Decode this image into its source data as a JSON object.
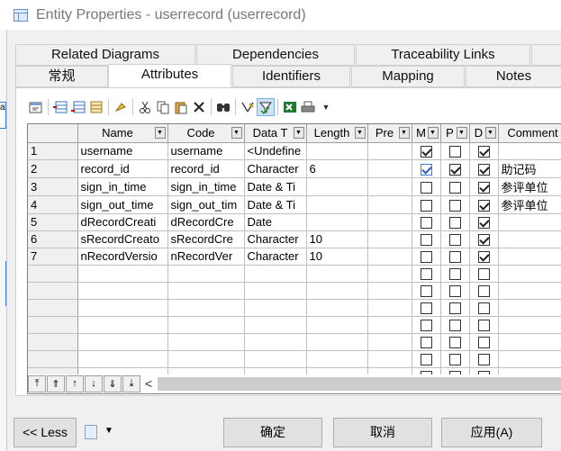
{
  "window": {
    "title": "Entity Properties - userrecord (userrecord)"
  },
  "tabs_row1": [
    "Related Diagrams",
    "Dependencies",
    "Traceability Links"
  ],
  "tabs_row2": [
    "常规",
    "Attributes",
    "Identifiers",
    "Mapping",
    "Notes"
  ],
  "active_tab": "Attributes",
  "columns": [
    "",
    "Name",
    "Code",
    "Data T",
    "Length",
    "Pre",
    "M",
    "P",
    "D",
    "Comment"
  ],
  "rows": [
    {
      "n": "1",
      "name": "username",
      "code": "username",
      "type": "<Undefine",
      "length": "",
      "pre": "",
      "m": true,
      "p": false,
      "d": true,
      "comment": ""
    },
    {
      "n": "2",
      "name": "record_id",
      "code": "record_id",
      "type": "Character",
      "length": "6",
      "pre": "",
      "m": true,
      "p": true,
      "d": true,
      "comment": "助记码"
    },
    {
      "n": "3",
      "name": "sign_in_time",
      "code": "sign_in_time",
      "type": "Date & Ti",
      "length": "",
      "pre": "",
      "m": false,
      "p": false,
      "d": true,
      "comment": "参评单位"
    },
    {
      "n": "4",
      "name": "sign_out_time",
      "code": "sign_out_tim",
      "type": "Date & Ti",
      "length": "",
      "pre": "",
      "m": false,
      "p": false,
      "d": true,
      "comment": "参评单位"
    },
    {
      "n": "5",
      "name": "dRecordCreati",
      "code": "dRecordCre",
      "type": "Date",
      "length": "",
      "pre": "",
      "m": false,
      "p": false,
      "d": true,
      "comment": ""
    },
    {
      "n": "6",
      "name": "sRecordCreato",
      "code": "sRecordCre",
      "type": "Character",
      "length": "10",
      "pre": "",
      "m": false,
      "p": false,
      "d": true,
      "comment": ""
    },
    {
      "n": "7",
      "name": "nRecordVersio",
      "code": "nRecordVer",
      "type": "Character",
      "length": "10",
      "pre": "",
      "m": false,
      "p": false,
      "d": true,
      "comment": ""
    }
  ],
  "toolbar_icons": [
    "properties-icon",
    "insert-row-icon",
    "add-row-icon",
    "add-attributes-icon",
    "show-domain-icon",
    "cut-icon",
    "copy-icon",
    "paste-icon",
    "delete-icon",
    "find-icon",
    "filter-icon",
    "enable-filter-icon",
    "excel-export-icon",
    "print-icon",
    "toolbar-dropdown-icon"
  ],
  "nav_icons": [
    "move-top-icon",
    "move-page-up-icon",
    "move-up-icon",
    "move-down-icon",
    "move-page-down-icon",
    "move-bottom-icon"
  ],
  "buttons": {
    "less": "<< Less",
    "ok": "确定",
    "cancel": "取消",
    "apply": "应用(A)"
  },
  "colors": {
    "check_blue": "#3a7bd5"
  }
}
